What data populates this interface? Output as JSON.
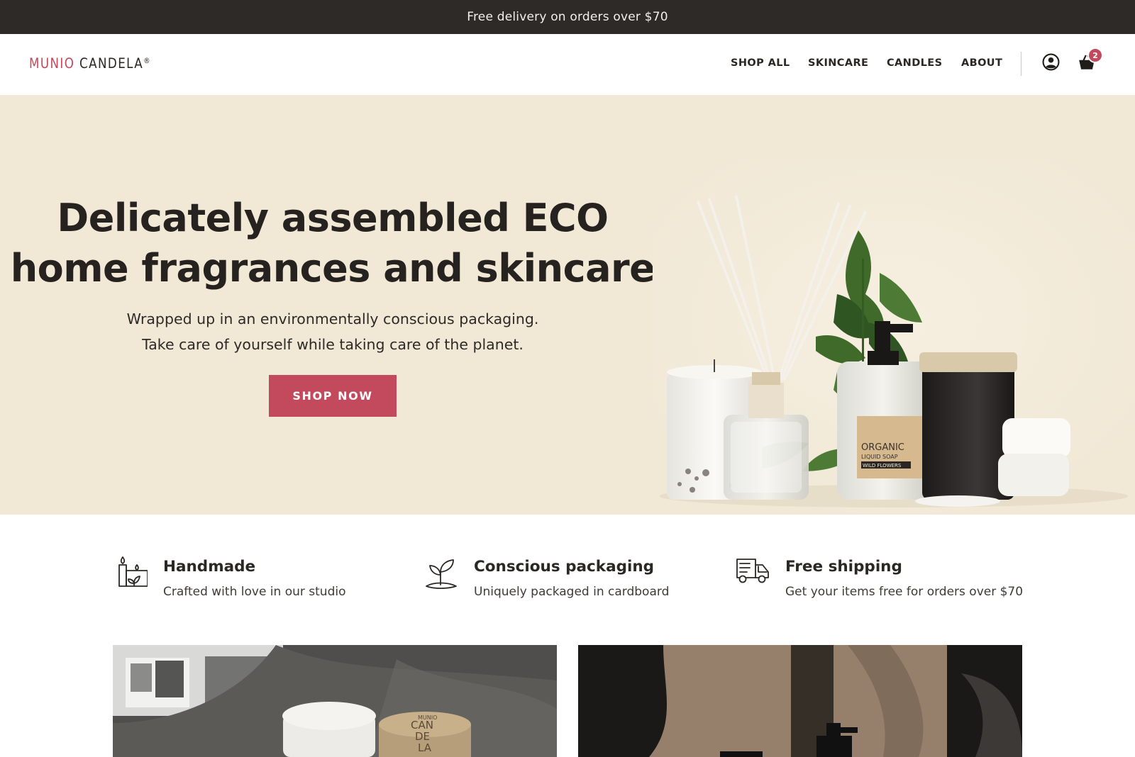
{
  "announcement": "Free delivery on orders over $70",
  "brand": {
    "part1": "MUNIO",
    "part2": "CANDELA",
    "mark": "®"
  },
  "nav": [
    "SHOP ALL",
    "SKINCARE",
    "CANDLES",
    "ABOUT"
  ],
  "cart": {
    "count": "2"
  },
  "hero": {
    "title_line1": "Delicately assembled ECO",
    "title_line2": "home fragrances and skincare",
    "sub_line1": "Wrapped up in an environmentally conscious packaging.",
    "sub_line2": "Take care of yourself while taking care of the planet.",
    "cta": "SHOP NOW",
    "label": {
      "l1": "ORGANIC",
      "l2": "LIQUID SOAP",
      "l3": "WILD FLOWERS"
    }
  },
  "features": [
    {
      "title": "Handmade",
      "desc": "Crafted with love in our studio",
      "icon": "candles-icon"
    },
    {
      "title": "Conscious packaging",
      "desc": "Uniquely packaged in cardboard",
      "icon": "sprout-icon"
    },
    {
      "title": "Free shipping",
      "desc": "Get your items free for orders over $70",
      "icon": "truck-icon"
    }
  ],
  "lid_text": {
    "l1": "MUNIO",
    "l2": "CAN",
    "l3": "DE",
    "l4": "LA"
  },
  "colors": {
    "accent": "#c24a5c",
    "dark": "#2d2a28",
    "hero_bg": "#f1e8d6"
  }
}
